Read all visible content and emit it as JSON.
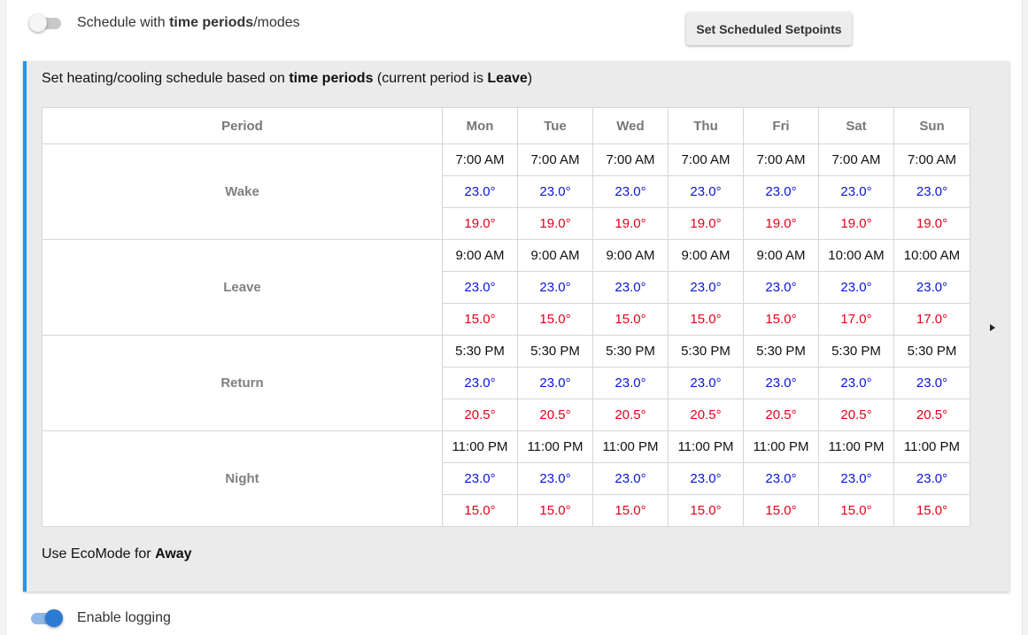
{
  "schedule_toggle": {
    "on": false,
    "label_pre": "Schedule with ",
    "label_bold": "time periods",
    "label_post": "/modes"
  },
  "set_button": "Set Scheduled Setpoints",
  "panel": {
    "title_pre": "Set heating/cooling schedule based on ",
    "title_bold": "time periods",
    "title_mid": " (current period is ",
    "title_period": "Leave",
    "title_post": ")",
    "footer_pre": "Use EcoMode for ",
    "footer_bold": "Away"
  },
  "table": {
    "period_header": "Period",
    "days": [
      "Mon",
      "Tue",
      "Wed",
      "Thu",
      "Fri",
      "Sat",
      "Sun"
    ],
    "periods": [
      {
        "name": "Wake",
        "times": [
          "7:00 AM",
          "7:00 AM",
          "7:00 AM",
          "7:00 AM",
          "7:00 AM",
          "7:00 AM",
          "7:00 AM"
        ],
        "cool": [
          "23.0°",
          "23.0°",
          "23.0°",
          "23.0°",
          "23.0°",
          "23.0°",
          "23.0°"
        ],
        "heat": [
          "19.0°",
          "19.0°",
          "19.0°",
          "19.0°",
          "19.0°",
          "19.0°",
          "19.0°"
        ]
      },
      {
        "name": "Leave",
        "times": [
          "9:00 AM",
          "9:00 AM",
          "9:00 AM",
          "9:00 AM",
          "9:00 AM",
          "10:00 AM",
          "10:00 AM"
        ],
        "cool": [
          "23.0°",
          "23.0°",
          "23.0°",
          "23.0°",
          "23.0°",
          "23.0°",
          "23.0°"
        ],
        "heat": [
          "15.0°",
          "15.0°",
          "15.0°",
          "15.0°",
          "15.0°",
          "17.0°",
          "17.0°"
        ]
      },
      {
        "name": "Return",
        "times": [
          "5:30 PM",
          "5:30 PM",
          "5:30 PM",
          "5:30 PM",
          "5:30 PM",
          "5:30 PM",
          "5:30 PM"
        ],
        "cool": [
          "23.0°",
          "23.0°",
          "23.0°",
          "23.0°",
          "23.0°",
          "23.0°",
          "23.0°"
        ],
        "heat": [
          "20.5°",
          "20.5°",
          "20.5°",
          "20.5°",
          "20.5°",
          "20.5°",
          "20.5°"
        ]
      },
      {
        "name": "Night",
        "times": [
          "11:00 PM",
          "11:00 PM",
          "11:00 PM",
          "11:00 PM",
          "11:00 PM",
          "11:00 PM",
          "11:00 PM"
        ],
        "cool": [
          "23.0°",
          "23.0°",
          "23.0°",
          "23.0°",
          "23.0°",
          "23.0°",
          "23.0°"
        ],
        "heat": [
          "15.0°",
          "15.0°",
          "15.0°",
          "15.0°",
          "15.0°",
          "15.0°",
          "15.0°"
        ]
      }
    ]
  },
  "logging_toggle": {
    "on": true,
    "label": "Enable logging"
  },
  "colors": {
    "accent": "#2196f3",
    "cool_setpoint": "#0a14d8",
    "heat_setpoint": "#e4001b",
    "toggle_on": "#2b7bd3"
  },
  "icons": {
    "scroll_right": "play-right-icon"
  }
}
